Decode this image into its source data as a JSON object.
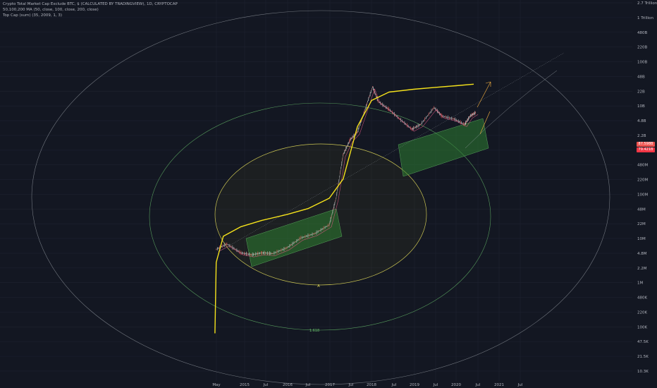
{
  "legend": {
    "line1": "Crypto Total Market Cap Exclude BTC, $ (CALCULATED BY TRADINGVIEW), 1D, CRYPTOCAP",
    "line2": "50,100,200 MA (50, close, 100, close, 200, close)",
    "line3": "Top Cap (sum) (35, 2009, 1, 3)"
  },
  "price_badges": [
    {
      "label": "87.598B",
      "color": "#ef5350"
    },
    {
      "label": "79.421B",
      "color": "#f23645"
    }
  ],
  "colors": {
    "background": "#131722",
    "grid": "#1e2230",
    "top_cap": "#f5e21b",
    "candles": "#c8c8c8",
    "ma_pink": "#e85a8a",
    "channel_fill": "#2e7d32",
    "outer_ring": "#9aa0a6",
    "middle_ring": "#66bb6a",
    "inner_ring": "#e8e05a",
    "projection": "#9aa0a6",
    "orange": "#f5b041"
  },
  "chart_data": {
    "type": "line",
    "title": "Crypto Total Market Cap Exclude BTC, $ (CALCULATED BY TRADINGVIEW), 1D, CRYPTOCAP",
    "x_ticks": [
      "May",
      "2015",
      "Jul",
      "2016",
      "Jul",
      "2017",
      "Jul",
      "2018",
      "Jul",
      "2019",
      "Jul",
      "2020",
      "Jul",
      "2021",
      "Jul"
    ],
    "y_ticks": [
      "2.7 Trillion",
      "1 Trillion",
      "480B",
      "220B",
      "100B",
      "48B",
      "22B",
      "10B",
      "4.8B",
      "2.2B",
      "1B",
      "480M",
      "220M",
      "100M",
      "48M",
      "22M",
      "10M",
      "4.8M",
      "2.2M",
      "1M",
      "480K",
      "220K",
      "100K",
      "47.5K",
      "21.5K",
      "10.3K"
    ],
    "y_scale": "log",
    "annotations": [
      "A",
      "1.618"
    ],
    "series": [
      {
        "name": "Top Cap (sum)",
        "color": "#f5e21b",
        "points": [
          [
            "2014-04-20",
            700000
          ],
          [
            "2014-05-01",
            30000000
          ],
          [
            "2014-07-01",
            120000000
          ],
          [
            "2014-12-01",
            200000000
          ],
          [
            "2015-06-01",
            280000000
          ],
          [
            "2016-01-01",
            380000000
          ],
          [
            "2016-07-01",
            520000000
          ],
          [
            "2017-01-01",
            900000000
          ],
          [
            "2017-05-01",
            2500000000
          ],
          [
            "2017-09-01",
            40000000000
          ],
          [
            "2018-01-01",
            160000000000
          ],
          [
            "2018-06-01",
            250000000000
          ],
          [
            "2019-01-01",
            290000000000
          ],
          [
            "2019-07-01",
            320000000000
          ],
          [
            "2020-01-01",
            350000000000
          ],
          [
            "2020-06-01",
            380000000000
          ]
        ]
      },
      {
        "name": "Crypto Total Market Cap Exclude BTC",
        "color": "#c8c8c8",
        "points": [
          [
            "2014-05-01",
            60000000
          ],
          [
            "2014-08-01",
            80000000
          ],
          [
            "2014-12-01",
            50000000
          ],
          [
            "2015-03-01",
            45000000
          ],
          [
            "2015-06-01",
            50000000
          ],
          [
            "2015-09-01",
            48000000
          ],
          [
            "2016-01-01",
            65000000
          ],
          [
            "2016-05-01",
            110000000
          ],
          [
            "2016-09-01",
            140000000
          ],
          [
            "2017-01-01",
            220000000
          ],
          [
            "2017-03-01",
            900000000
          ],
          [
            "2017-05-01",
            9000000000
          ],
          [
            "2017-07-01",
            20000000000
          ],
          [
            "2017-09-01",
            30000000000
          ],
          [
            "2017-11-01",
            90000000000
          ],
          [
            "2018-01-10",
            330000000000
          ],
          [
            "2018-03-01",
            150000000000
          ],
          [
            "2018-06-01",
            100000000000
          ],
          [
            "2018-09-01",
            60000000000
          ],
          [
            "2018-12-15",
            35000000000
          ],
          [
            "2019-03-01",
            45000000000
          ],
          [
            "2019-06-25",
            110000000000
          ],
          [
            "2019-09-01",
            70000000000
          ],
          [
            "2019-12-15",
            60000000000
          ],
          [
            "2020-03-15",
            45000000000
          ],
          [
            "2020-05-01",
            70000000000
          ],
          [
            "2020-06-20",
            85000000000
          ]
        ]
      }
    ]
  }
}
